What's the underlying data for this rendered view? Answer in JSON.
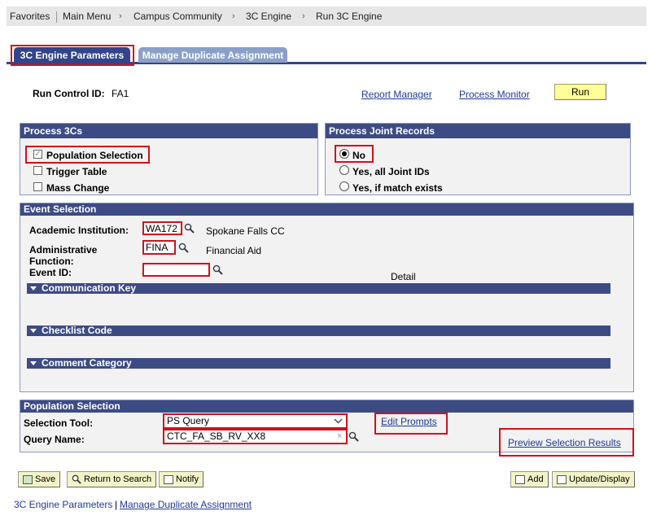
{
  "breadcrumb": {
    "items": [
      "Favorites",
      "Main Menu",
      "Campus Community",
      "3C Engine",
      "Run 3C Engine"
    ]
  },
  "tabs": [
    {
      "label": "3C Engine Parameters",
      "active": true
    },
    {
      "label": "Manage Duplicate Assignment",
      "active": false
    }
  ],
  "run_control": {
    "label": "Run Control ID:",
    "value": "FA1"
  },
  "links": {
    "report_manager": "Report Manager",
    "process_monitor": "Process Monitor"
  },
  "run_button": "Run",
  "process_3cs": {
    "title": "Process 3Cs",
    "items": [
      {
        "label": "Population Selection",
        "checked": true
      },
      {
        "label": "Trigger Table",
        "checked": false
      },
      {
        "label": "Mass Change",
        "checked": false
      }
    ]
  },
  "joint_records": {
    "title": "Process Joint Records",
    "options": [
      {
        "label": "No",
        "selected": true
      },
      {
        "label": "Yes, all Joint IDs",
        "selected": false
      },
      {
        "label": "Yes, if match exists",
        "selected": false
      }
    ]
  },
  "event_selection": {
    "title": "Event Selection",
    "institution_label": "Academic Institution:",
    "institution_value": "WA172",
    "institution_desc": "Spokane Falls CC",
    "admin_label_1": "Administrative",
    "admin_label_2": "Function:",
    "admin_value": "FINA",
    "admin_desc": "Financial Aid",
    "event_label": "Event ID:",
    "event_value": "",
    "detail": "Detail",
    "collapsibles": [
      "Communication Key",
      "Checklist Code",
      "Comment Category"
    ]
  },
  "population_selection": {
    "title": "Population Selection",
    "tool_label": "Selection Tool:",
    "tool_value": "PS Query",
    "query_label": "Query Name:",
    "query_value": "CTC_FA_SB_RV_XX8",
    "edit_prompts": "Edit Prompts",
    "preview": "Preview Selection Results"
  },
  "footer_buttons": {
    "save": "Save",
    "return_to_search": "Return to Search",
    "notify": "Notify",
    "add": "Add",
    "update_display": "Update/Display"
  },
  "footer_links": [
    "3C Engine Parameters",
    "Manage Duplicate Assignment"
  ],
  "footer_sep": "|",
  "colors": {
    "header": "#3d4b85",
    "highlight": "#d1111a",
    "link": "#1f3a9a",
    "run_button": "#ffff99"
  }
}
